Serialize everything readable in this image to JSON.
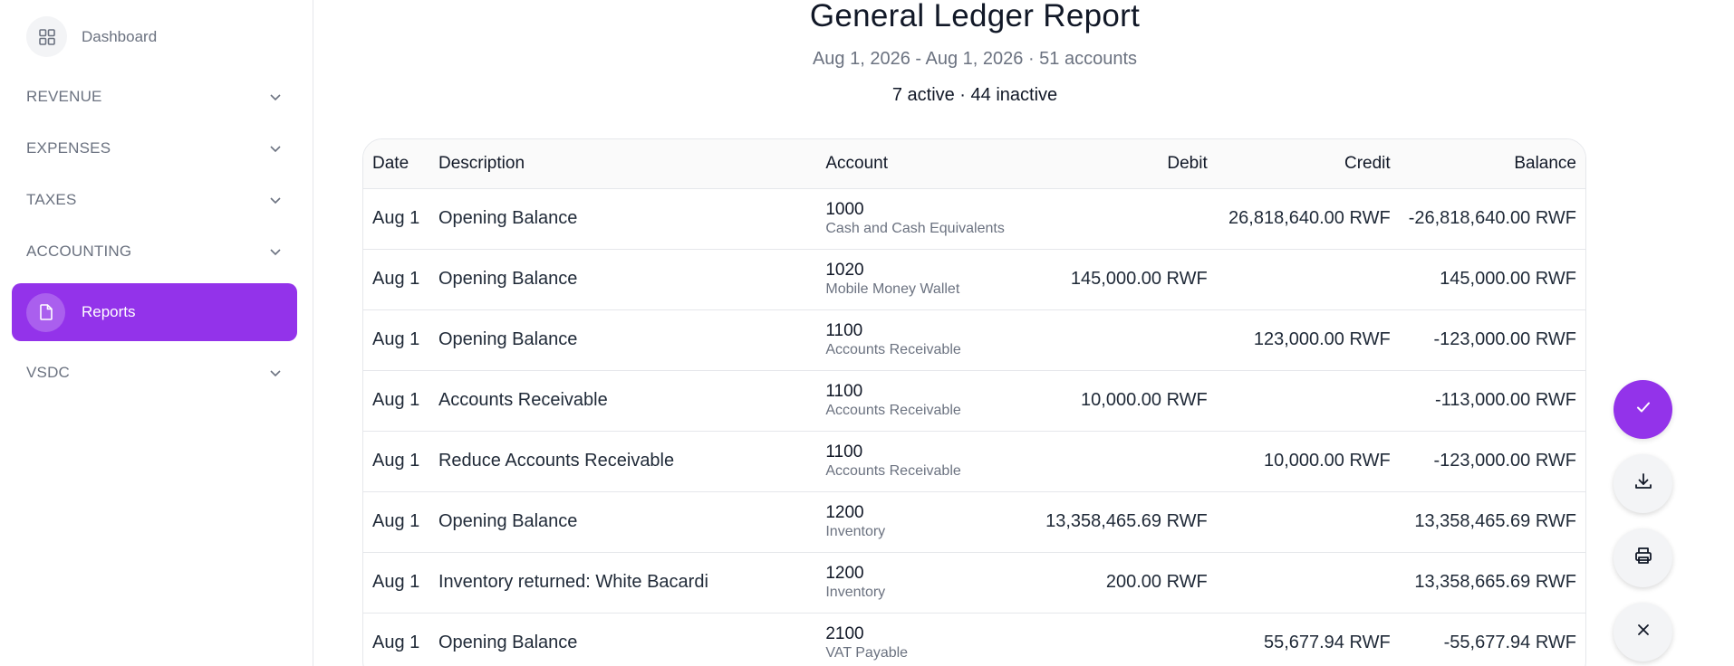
{
  "sidebar": {
    "dashboard_label": "Dashboard",
    "items": [
      {
        "label": "REVENUE"
      },
      {
        "label": "EXPENSES"
      },
      {
        "label": "TAXES"
      },
      {
        "label": "ACCOUNTING"
      },
      {
        "label": "Reports"
      },
      {
        "label": "VSDC"
      }
    ],
    "active_color": "#9333ea"
  },
  "report": {
    "title": "General Ledger Report",
    "subtitle": "Aug 1, 2026 - Aug 1, 2026 · 51 accounts",
    "counts": "7 active · 44 inactive"
  },
  "table": {
    "headers": {
      "date": "Date",
      "description": "Description",
      "account": "Account",
      "debit": "Debit",
      "credit": "Credit",
      "balance": "Balance"
    },
    "rows": [
      {
        "date": "Aug 1",
        "description": "Opening Balance",
        "account_number": "1000",
        "account_name": "Cash and Cash Equivalents",
        "debit": "",
        "credit": "26,818,640.00 RWF",
        "balance": "-26,818,640.00 RWF"
      },
      {
        "date": "Aug 1",
        "description": "Opening Balance",
        "account_number": "1020",
        "account_name": "Mobile Money Wallet",
        "debit": "145,000.00 RWF",
        "credit": "",
        "balance": "145,000.00 RWF"
      },
      {
        "date": "Aug 1",
        "description": "Opening Balance",
        "account_number": "1100",
        "account_name": "Accounts Receivable",
        "debit": "",
        "credit": "123,000.00 RWF",
        "balance": "-123,000.00 RWF"
      },
      {
        "date": "Aug 1",
        "description": "Accounts Receivable",
        "account_number": "1100",
        "account_name": "Accounts Receivable",
        "debit": "10,000.00 RWF",
        "credit": "",
        "balance": "-113,000.00 RWF"
      },
      {
        "date": "Aug 1",
        "description": "Reduce Accounts Receivable",
        "account_number": "1100",
        "account_name": "Accounts Receivable",
        "debit": "",
        "credit": "10,000.00 RWF",
        "balance": "-123,000.00 RWF"
      },
      {
        "date": "Aug 1",
        "description": "Opening Balance",
        "account_number": "1200",
        "account_name": "Inventory",
        "debit": "13,358,465.69 RWF",
        "credit": "",
        "balance": "13,358,465.69 RWF"
      },
      {
        "date": "Aug 1",
        "description": "Inventory returned: White Bacardi",
        "account_number": "1200",
        "account_name": "Inventory",
        "debit": "200.00 RWF",
        "credit": "",
        "balance": "13,358,665.69 RWF"
      },
      {
        "date": "Aug 1",
        "description": "Opening Balance",
        "account_number": "2100",
        "account_name": "VAT Payable",
        "debit": "",
        "credit": "55,677.94 RWF",
        "balance": "-55,677.94 RWF"
      }
    ]
  },
  "actions": {
    "confirm_icon": "check-icon",
    "download_icon": "download-icon",
    "print_icon": "printer-icon",
    "close_icon": "close-icon"
  }
}
